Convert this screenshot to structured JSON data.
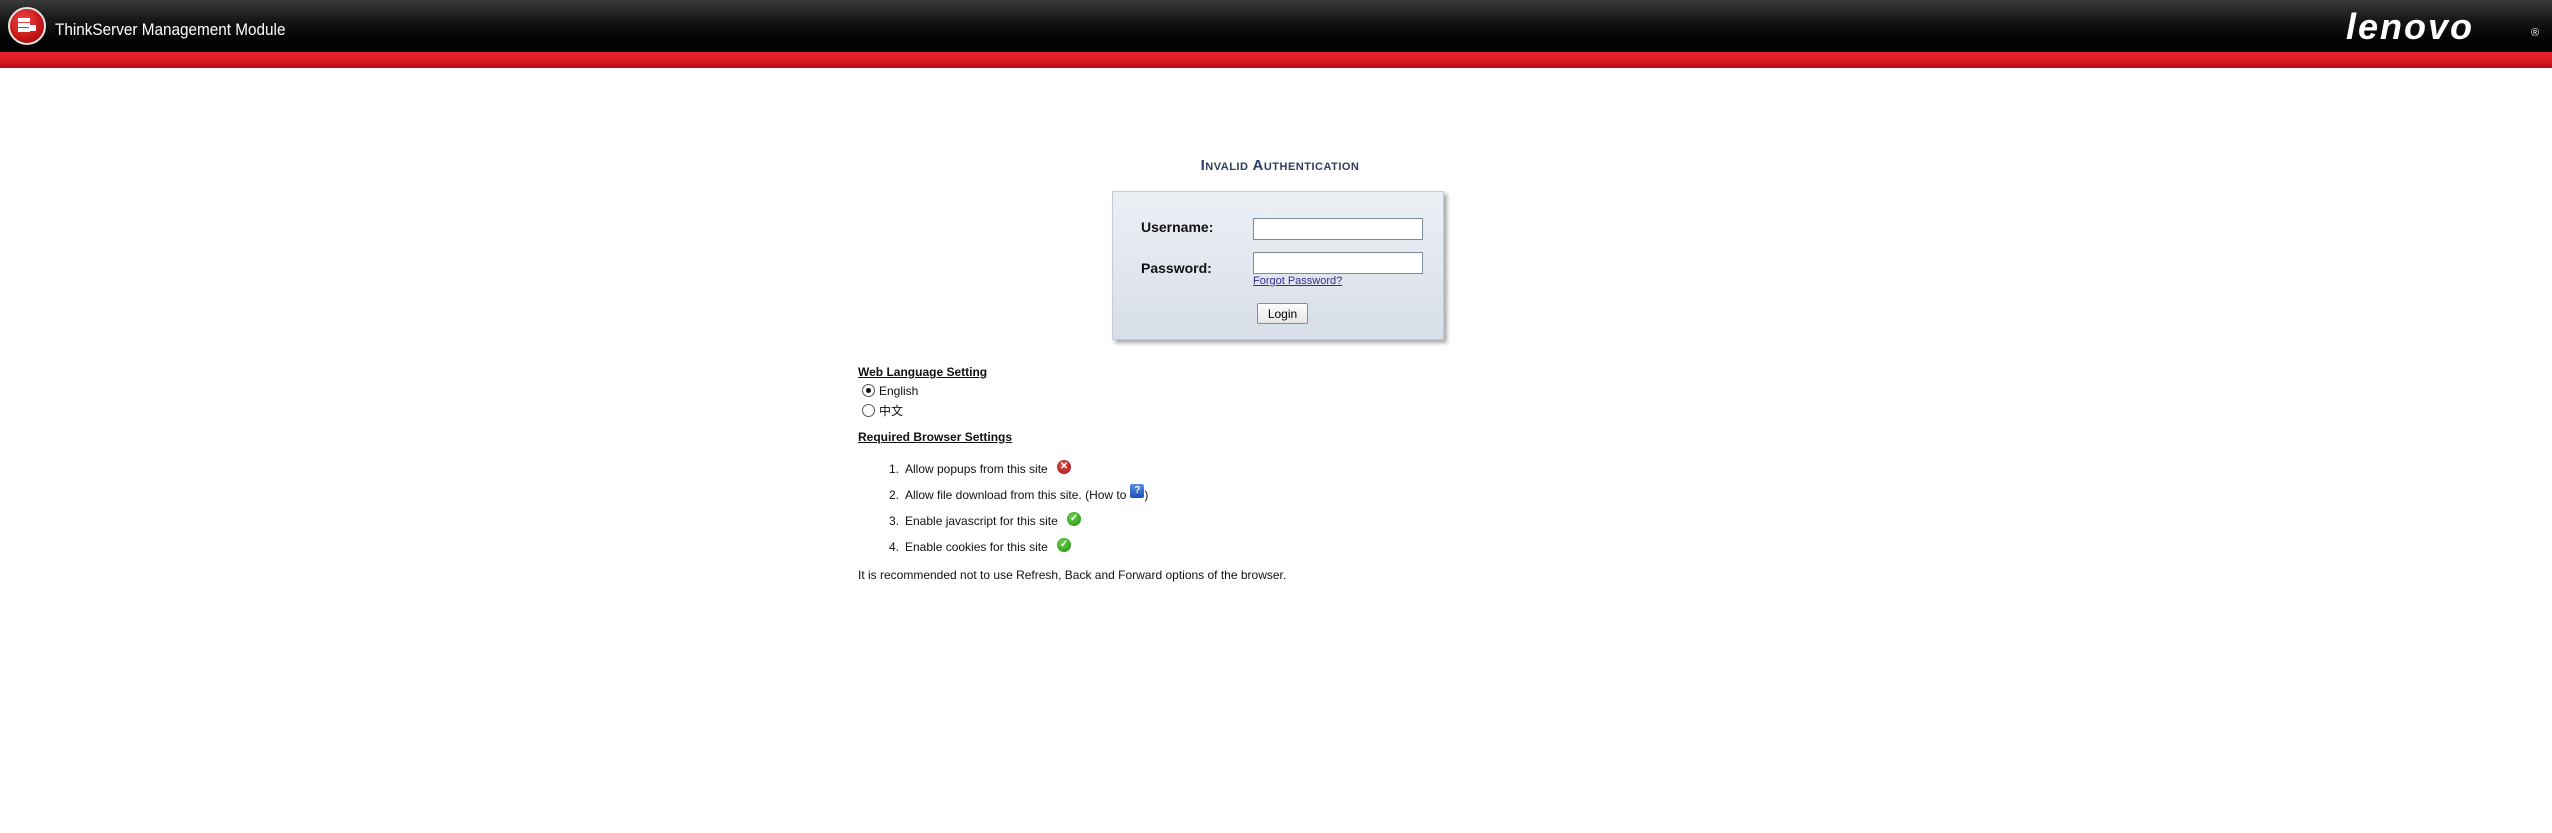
{
  "header": {
    "app_title": "ThinkServer Management Module",
    "brand": "lenovo",
    "brand_mark": "®",
    "colors": {
      "header_bg": "#000000",
      "accent_red": "#d81820"
    }
  },
  "auth": {
    "title": "Invalid Authentication",
    "username_label": "Username:",
    "username_value": "",
    "password_label": "Password:",
    "password_value": "",
    "forgot_password": "Forgot Password?",
    "login_label": "Login"
  },
  "language": {
    "heading": "Web Language Setting",
    "options": [
      {
        "label": "English",
        "selected": true
      },
      {
        "label": "中文",
        "selected": false
      }
    ]
  },
  "browser_settings": {
    "heading": "Required Browser Settings",
    "items": [
      {
        "num": "1.",
        "text": "Allow popups from this site",
        "status": "error-icon"
      },
      {
        "num": "2.",
        "text": "Allow file download from this site. (How to",
        "suffix": ")",
        "status": "help-icon"
      },
      {
        "num": "3.",
        "text": "Enable javascript for this site",
        "status": "ok-icon"
      },
      {
        "num": "4.",
        "text": "Enable cookies for this site",
        "status": "ok-icon"
      }
    ],
    "note": "It is recommended not to use Refresh, Back and Forward options of the browser."
  }
}
